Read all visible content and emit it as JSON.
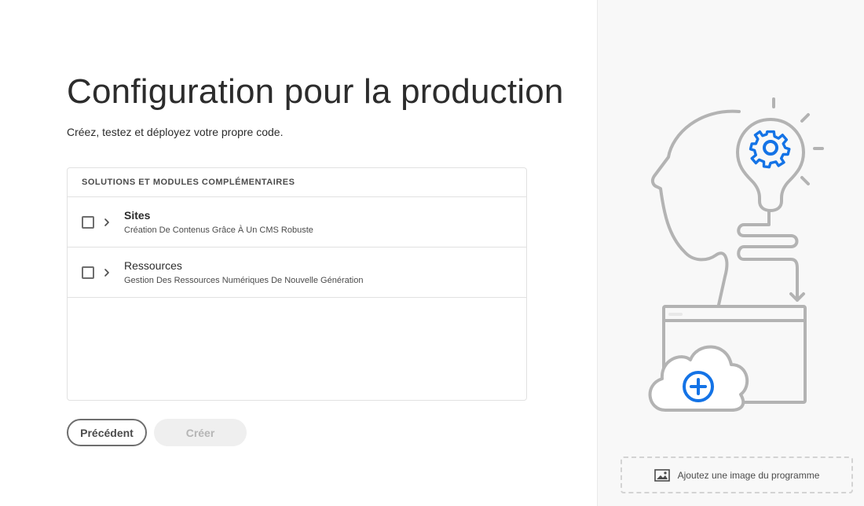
{
  "page": {
    "title": "Configuration pour la production",
    "subtitle": "Créez, testez et déployez votre propre code."
  },
  "panel": {
    "header": "SOLUTIONS ET MODULES COMPLÉMENTAIRES",
    "items": [
      {
        "title": "Sites",
        "description": "Création De Contenus Grâce À Un CMS Robuste",
        "checked": false
      },
      {
        "title": "Ressources",
        "description": "Gestion Des Ressources Numériques De Nouvelle Génération",
        "checked": false
      }
    ]
  },
  "buttons": {
    "previous": "Précédent",
    "create": "Créer"
  },
  "side": {
    "add_image_label": "Ajoutez une image du programme",
    "illustration_icons": [
      "head-outline-icon",
      "lightbulb-gear-icon",
      "browser-window-icon",
      "cloud-plus-icon"
    ]
  },
  "colors": {
    "accent": "#1473e6",
    "illustration_stroke": "#b3b3b3",
    "disabled_button_bg": "#efefef",
    "disabled_button_text": "#b5b5b5"
  }
}
